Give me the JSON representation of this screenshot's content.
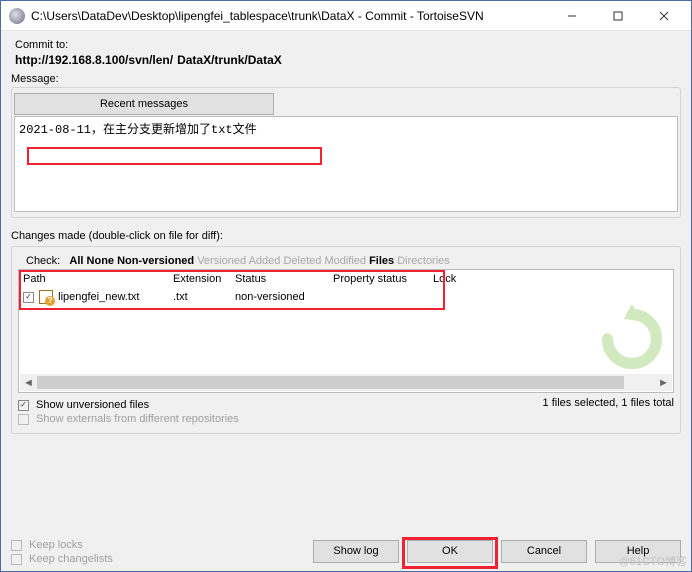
{
  "window": {
    "title": "C:\\Users\\DataDev\\Desktop\\lipengfei_tablespace\\trunk\\DataX - Commit - TortoiseSVN"
  },
  "commit_to": {
    "label": "Commit to:",
    "url_prefix": "http://192.168.8.100/svn/len/",
    "url_suffix": "DataX/trunk/DataX"
  },
  "message": {
    "label": "Message:",
    "recent_btn": "Recent messages",
    "text": "2021-08-11，在主分支更新增加了txt文件"
  },
  "changes": {
    "label": "Changes made (double-click on file for diff):",
    "check_label": "Check:",
    "filters": {
      "all": "All",
      "none": "None",
      "nonversioned": "Non-versioned",
      "versioned": "Versioned",
      "added": "Added",
      "deleted": "Deleted",
      "modified": "Modified",
      "files": "Files",
      "directories": "Directories"
    },
    "columns": {
      "path": "Path",
      "ext": "Extension",
      "status": "Status",
      "prop": "Property status",
      "lock": "Lock"
    },
    "rows": [
      {
        "checked": true,
        "name": "lipengfei_new.txt",
        "ext": ".txt",
        "status": "non-versioned",
        "prop": "",
        "lock": ""
      }
    ]
  },
  "options": {
    "show_unversioned": "Show unversioned files",
    "show_externals": "Show externals from different repositories",
    "keep_locks": "Keep locks",
    "keep_changelists": "Keep changelists"
  },
  "status": "1 files selected, 1 files total",
  "buttons": {
    "showlog": "Show log",
    "ok": "OK",
    "cancel": "Cancel",
    "help": "Help"
  },
  "watermark": "@51CTO博客"
}
